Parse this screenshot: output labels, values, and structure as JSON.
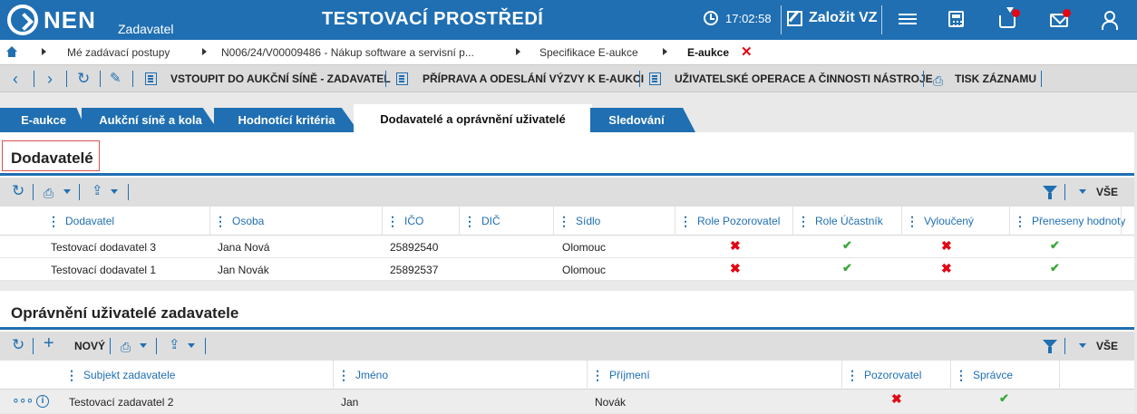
{
  "header": {
    "logo_text": "NEN",
    "logo_sub": "Zadavatel",
    "environment": "TESTOVACÍ PROSTŘEDÍ",
    "time": "17:02:58",
    "create_label": "Založit VZ",
    "icons": [
      "menu-icon",
      "calculator-icon",
      "inbox-icon",
      "mail-icon",
      "user-icon"
    ],
    "accent": "#1f6fb2",
    "notify_color": "#e30613"
  },
  "breadcrumb": {
    "items": [
      "Mé zadávací postupy",
      "N006/24/V00009486 - Nákup software a servisní p...",
      "Specifikace E-aukce",
      "E-aukce"
    ],
    "close": "✕"
  },
  "actions": {
    "enter_hall": "VSTOUPIT DO AUKČNÍ SÍNĚ - ZADAVATEL",
    "prepare": "PŘÍPRAVA A ODESLÁNÍ VÝZVY K E-AUKCI",
    "operations": "UŽIVATELSKÉ OPERACE A ČINNOSTI NÁSTROJE",
    "print": "TISK ZÁZNAMU"
  },
  "tabs": [
    {
      "label": "E-aukce"
    },
    {
      "label": "Aukční síně a kola"
    },
    {
      "label": "Hodnotící kritéria"
    },
    {
      "label": "Dodavatelé a oprávnění uživatelé"
    },
    {
      "label": "Sledování"
    }
  ],
  "suppliers": {
    "title": "Dodavatelé",
    "all_label": "VŠE",
    "columns": [
      "Dodavatel",
      "Osoba",
      "IČO",
      "DIČ",
      "Sídlo",
      "Role Pozorovatel",
      "Role Účastník",
      "Vyloučený",
      "Přeneseny hodnoty"
    ],
    "rows": [
      {
        "dodavatel": "Testovací dodavatel 3",
        "osoba": "Jana Nová",
        "ico": "25892540",
        "dic": "",
        "sidlo": "Olomouc",
        "pozorovatel": false,
        "ucastnik": true,
        "vylouceny": false,
        "preneseny": true
      },
      {
        "dodavatel": "Testovací dodavatel 1",
        "osoba": "Jan Novák",
        "ico": "25892537",
        "dic": "",
        "sidlo": "Olomouc",
        "pozorovatel": false,
        "ucastnik": true,
        "vylouceny": false,
        "preneseny": true
      }
    ]
  },
  "users": {
    "title": "Oprávnění uživatelé zadavatele",
    "new_label": "NOVÝ",
    "all_label": "VŠE",
    "columns": [
      "Subjekt zadavatele",
      "Jméno",
      "Příjmení",
      "Pozorovatel",
      "Správce"
    ],
    "rows": [
      {
        "subjekt": "Testovací zadavatel 2",
        "jmeno": "Jan",
        "prijmeni": "Novák",
        "pozorovatel": false,
        "spravce": true
      }
    ]
  },
  "marks": {
    "yes": "✔",
    "no": "✖"
  }
}
